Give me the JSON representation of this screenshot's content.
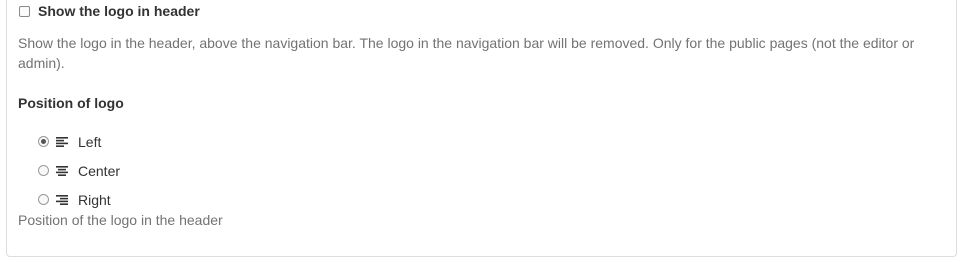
{
  "logo_setting": {
    "checkbox_label": "Show the logo in header",
    "checked": false,
    "help_text": "Show the logo in the header, above the navigation bar. The logo in the navigation bar will be removed. Only for the public pages (not the editor or admin)."
  },
  "position": {
    "title": "Position of logo",
    "options": [
      {
        "label": "Left",
        "icon": "align-left-icon",
        "selected": true
      },
      {
        "label": "Center",
        "icon": "align-center-icon",
        "selected": false
      },
      {
        "label": "Right",
        "icon": "align-right-icon",
        "selected": false
      }
    ],
    "help_text": "Position of the logo in the header"
  }
}
